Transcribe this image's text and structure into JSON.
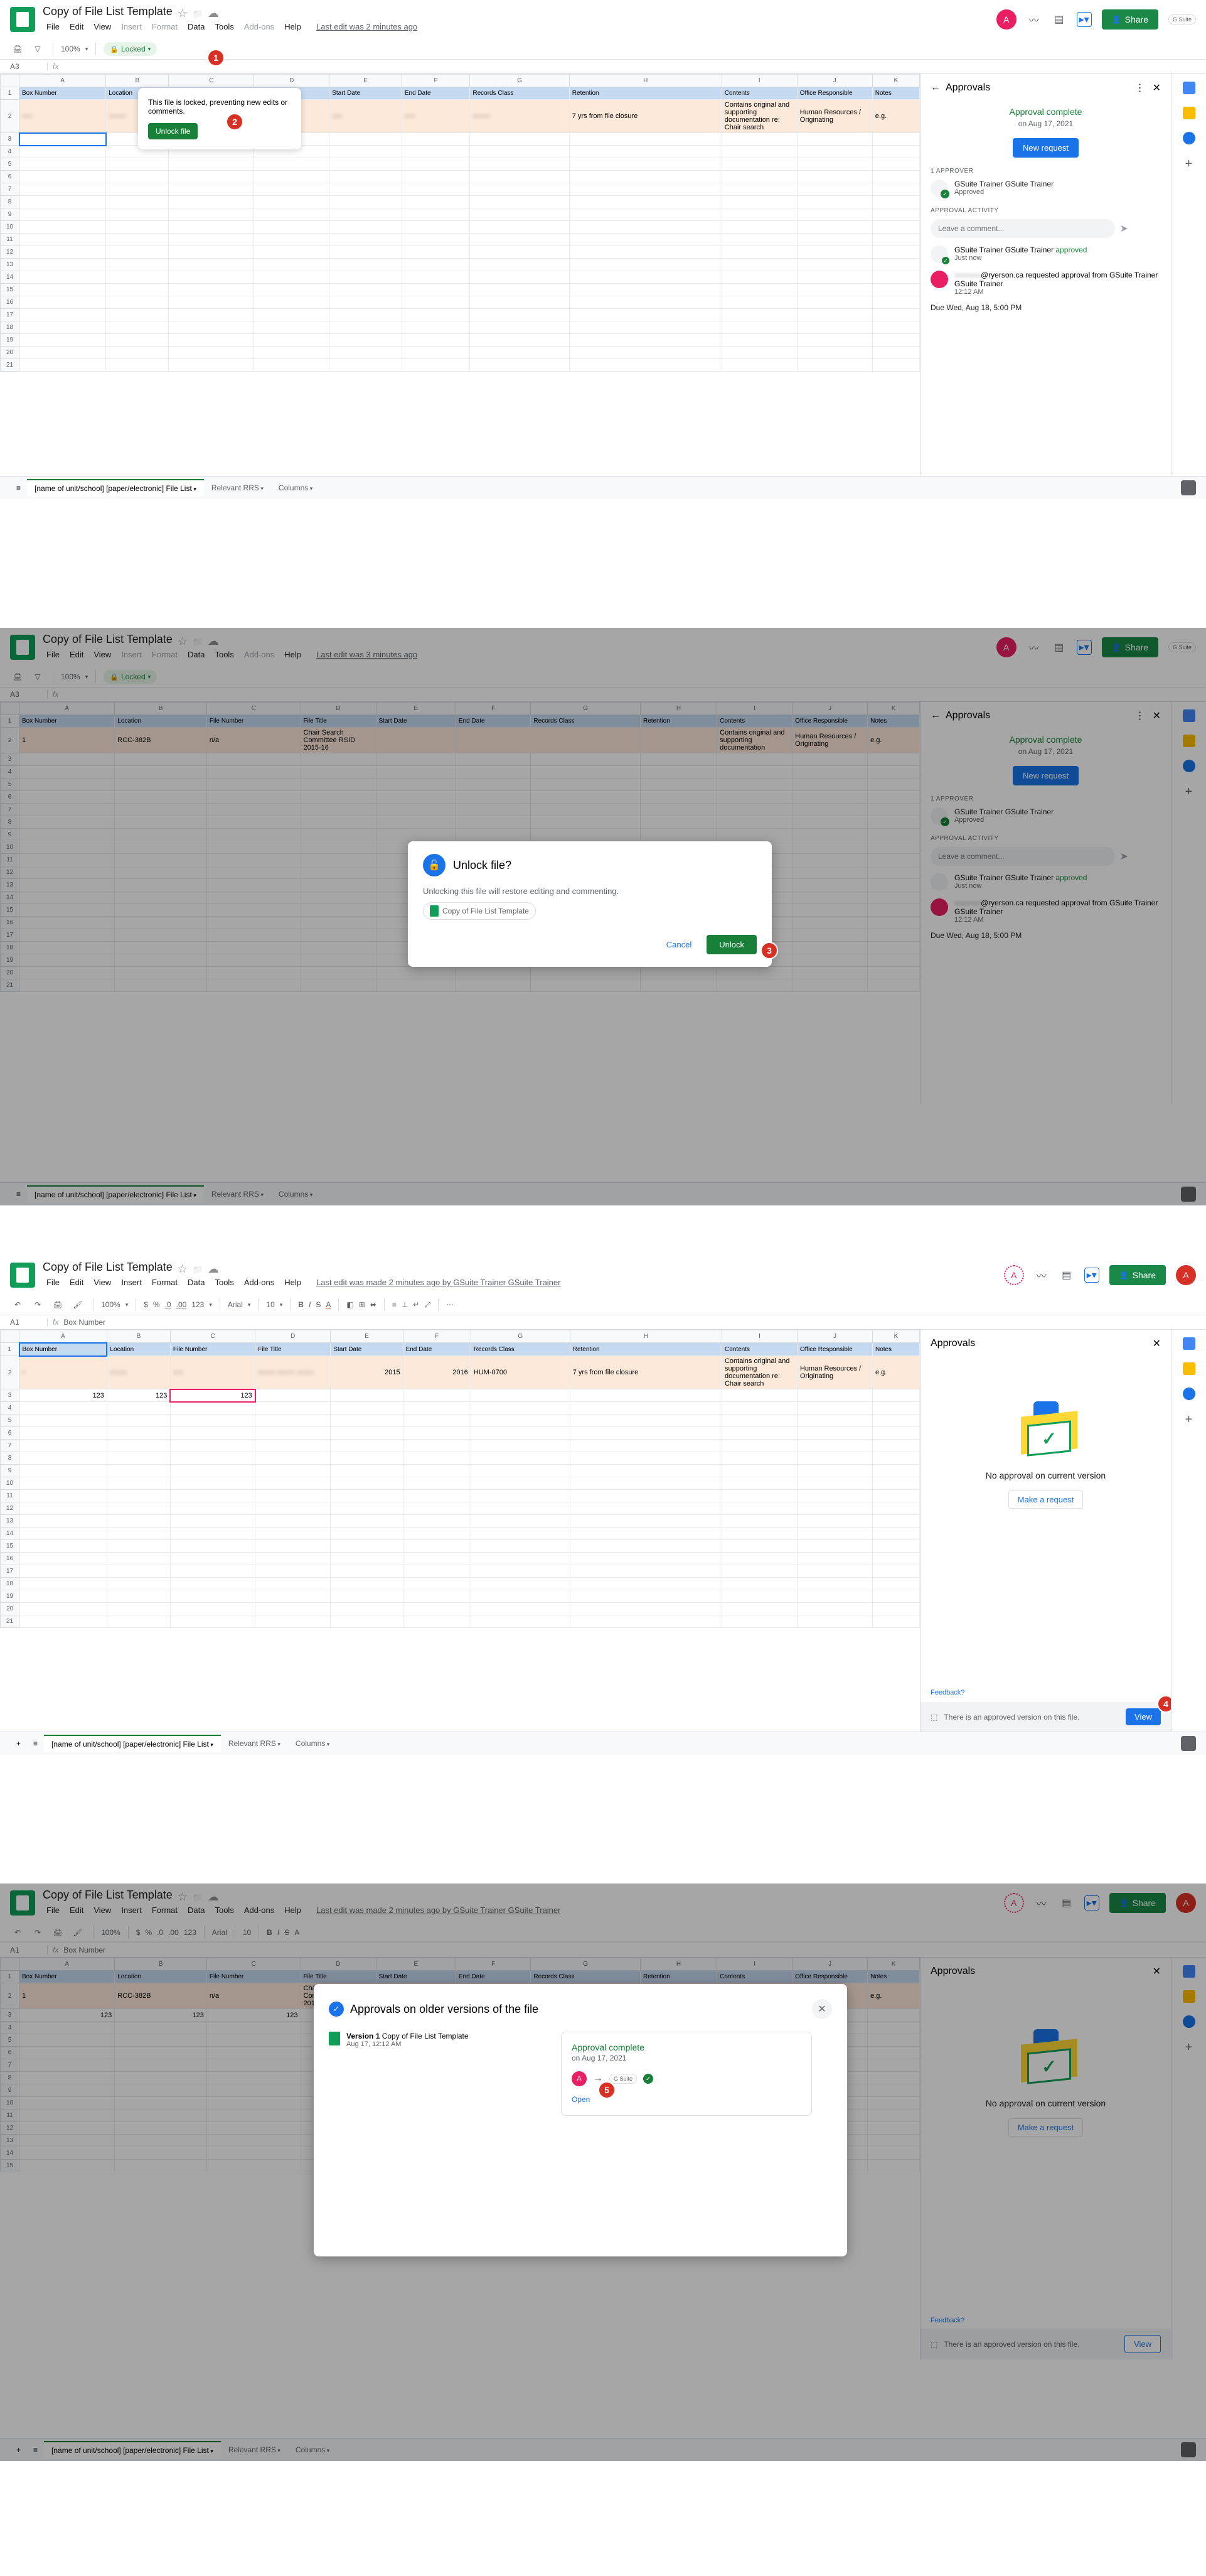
{
  "doc_title": "Copy of File List Template",
  "menubar": [
    "File",
    "Edit",
    "View",
    "Insert",
    "Format",
    "Data",
    "Tools",
    "Add-ons",
    "Help"
  ],
  "last_edit_locked": "Last edit was 2 minutes ago",
  "last_edit_s2": "Last edit was 3 minutes ago",
  "last_edit_s3": "Last edit was made 2 minutes ago by GSuite Trainer GSuite Trainer",
  "share": "Share",
  "gsuite": "G Suite",
  "zoom": "100%",
  "locked_label": "Locked",
  "cell_ref_a3": "A3",
  "cell_ref_a1": "A1",
  "formula_a1": "Box Number",
  "columns": [
    "A",
    "B",
    "C",
    "D",
    "E",
    "F",
    "G",
    "H",
    "I",
    "J",
    "K"
  ],
  "headers": {
    "box": "Box Number",
    "location": "Location",
    "filenum": "File Number",
    "filetitle": "File Title",
    "start": "Start Date",
    "end": "End Date",
    "records": "Records Class",
    "retention": "Retention",
    "contents": "Contents",
    "office": "Office Responsible",
    "notes": "Notes"
  },
  "row2": {
    "retention": "7 yrs from file closure",
    "contents": "Contains original and supporting documentation re: Chair search",
    "contents_short": "Contains original and supporting documentation",
    "office": "Human Resources / Originating",
    "eg": "e.g.",
    "n1": "1",
    "loc": "RCC-382B",
    "fn": "n/a",
    "title": "Chair Search Committee RSID 2015-16",
    "start": "2015",
    "end": "2016",
    "class": "HUM-0700"
  },
  "row3": {
    "a": "123",
    "b": "123",
    "c": "123"
  },
  "tooltip": {
    "text": "This file is locked, preventing new edits or comments.",
    "btn": "Unlock file"
  },
  "approvals": {
    "title": "Approvals",
    "complete": "Approval complete",
    "date": "on Aug 17, 2021",
    "new_request": "New request",
    "approver_label": "1 APPROVER",
    "approver_name": "GSuite Trainer GSuite Trainer",
    "approved": "Approved",
    "activity_label": "APPROVAL ACTIVITY",
    "comment_placeholder": "Leave a comment...",
    "activity1_name": "GSuite Trainer GSuite Trainer",
    "activity1_status": "approved",
    "activity1_time": "Just now",
    "activity2_email": "@ryerson.ca",
    "activity2_text1": "requested approval from",
    "activity2_text2": "GSuite Trainer GSuite Trainer",
    "activity2_time": "12:12 AM",
    "due": "Due Wed, Aug 18, 5:00 PM"
  },
  "unlock_modal": {
    "title": "Unlock file?",
    "body": "Unlocking this file will restore editing and commenting.",
    "filename": "Copy of File List Template",
    "cancel": "Cancel",
    "unlock": "Unlock"
  },
  "no_approval": {
    "text": "No approval on current version",
    "make": "Make a request",
    "feedback": "Feedback?",
    "banner": "There is an approved version on this file.",
    "view": "View"
  },
  "older": {
    "title": "Approvals on older versions of the file",
    "v_title": "Version 1",
    "v_file": "Copy of File List Template",
    "v_date": "Aug 17, 12:12 AM",
    "card_title": "Approval complete",
    "card_date": "on Aug 17, 2021",
    "open": "Open"
  },
  "sheet_tabs": {
    "main": "[name of unit/school] [paper/electronic] File List",
    "rrs": "Relevant RRS",
    "cols": "Columns"
  },
  "toolbar_full": {
    "currency": "$",
    "percent": "%",
    "dec_dec": ".0",
    "dec_inc": ".00",
    "more_fmt": "123",
    "font": "Arial",
    "size": "10"
  },
  "avatar_letter": "A",
  "badges": {
    "b1": "1",
    "b2": "2",
    "b3": "3",
    "b4": "4",
    "b5": "5"
  }
}
